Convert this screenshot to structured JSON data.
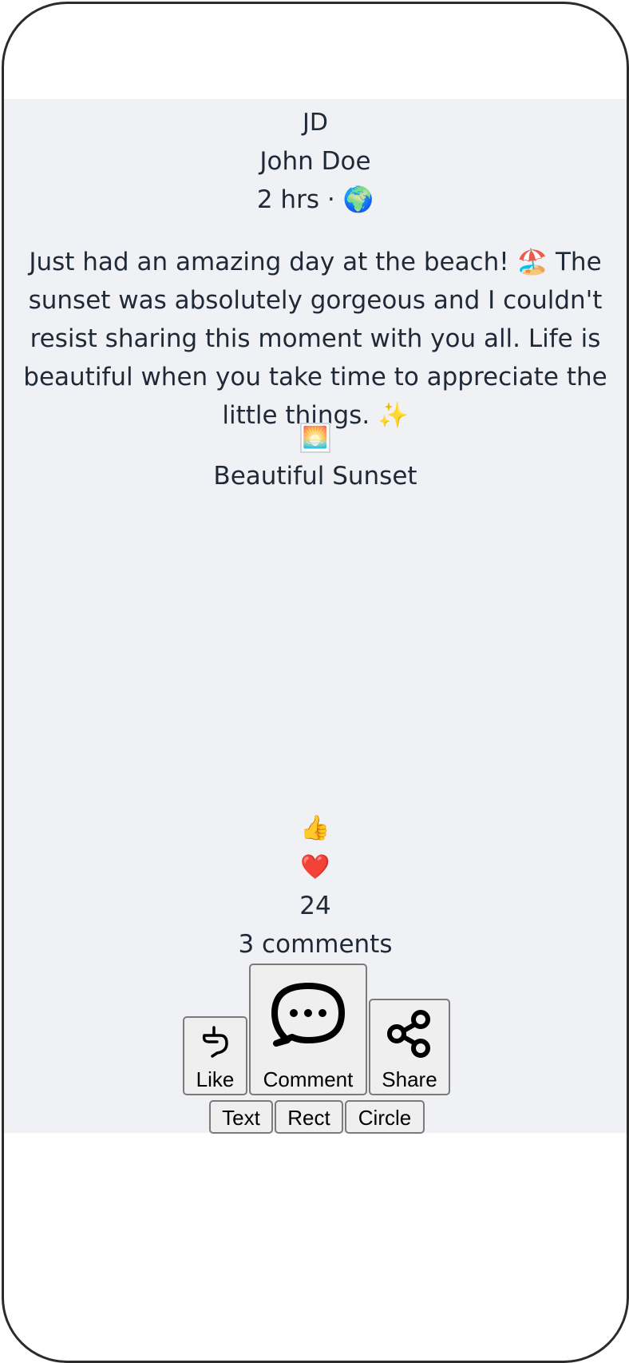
{
  "post": {
    "author_initials": "JD",
    "author_name": "John Doe",
    "meta": "2 hrs · 🌍",
    "text": "Just had an amazing day at the beach! 🏖️ The sunset was absolutely gorgeous and I couldn't resist sharing this moment with you all. Life is beautiful when you take time to appreciate the little things. ✨",
    "image_icon": "🌅",
    "image_caption": "Beautiful Sunset"
  },
  "reactions": {
    "like_emoji": "👍",
    "heart_emoji": "❤️",
    "count": "24",
    "comments": "3 comments"
  },
  "actions": {
    "like_label": "Like",
    "comment_label": "Comment",
    "share_label": "Share"
  },
  "tools": {
    "text_label": "Text",
    "rect_label": "Rect",
    "circle_label": "Circle"
  },
  "icons": {
    "like": "hand-like-icon",
    "comment": "speech-bubble-icon",
    "share": "share-nodes-icon"
  }
}
